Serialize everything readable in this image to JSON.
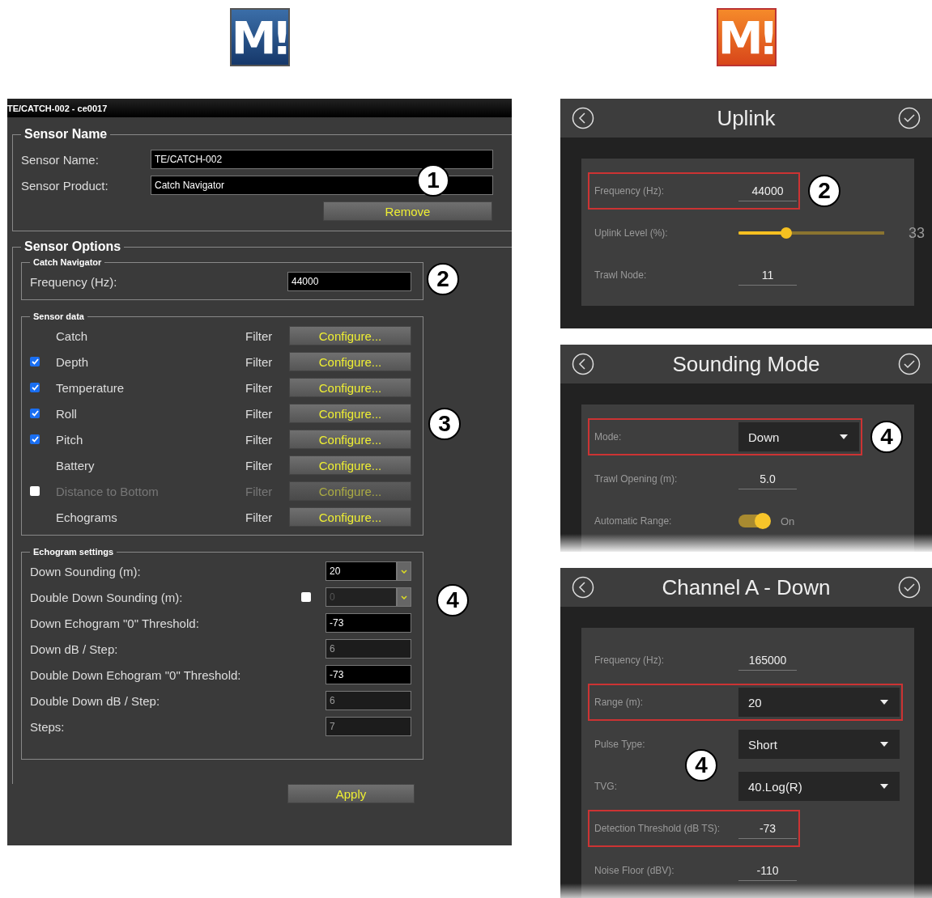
{
  "logos": [
    {
      "text": "M!",
      "kind": "blue"
    },
    {
      "text": "M!",
      "kind": "orange"
    }
  ],
  "desktop": {
    "title": "TE/CATCH-002 - ce0017",
    "sensor_name": {
      "legend": "Sensor Name",
      "callout": "1",
      "fields": [
        {
          "label": "Sensor Name:",
          "value": "TE/CATCH-002"
        },
        {
          "label": "Sensor Product:",
          "value": "Catch Navigator"
        }
      ],
      "button": "Remove"
    },
    "sensor_options": {
      "legend": "Sensor Options",
      "catch_navigator": {
        "legend": "Catch Navigator",
        "callout": "2",
        "label": "Frequency (Hz):",
        "value": "44000"
      },
      "sensor_data": {
        "legend": "Sensor data",
        "callout": "3",
        "rows": [
          {
            "kind": "plain",
            "name": "Catch",
            "filter": "Filter",
            "button": "Configure...",
            "disabled": false
          },
          {
            "kind": "checkbox",
            "checked": true,
            "name": "Depth",
            "filter": "Filter",
            "button": "Configure...",
            "disabled": false
          },
          {
            "kind": "checkbox",
            "checked": true,
            "name": "Temperature",
            "filter": "Filter",
            "button": "Configure...",
            "disabled": false
          },
          {
            "kind": "checkbox",
            "checked": true,
            "name": "Roll",
            "filter": "Filter",
            "button": "Configure...",
            "disabled": false
          },
          {
            "kind": "checkbox",
            "checked": true,
            "name": "Pitch",
            "filter": "Filter",
            "button": "Configure...",
            "disabled": false
          },
          {
            "kind": "plain",
            "name": "Battery",
            "filter": "Filter",
            "button": "Configure...",
            "disabled": false
          },
          {
            "kind": "checkbox",
            "checked": false,
            "name": "Distance to Bottom",
            "filter": "Filter",
            "button": "Configure...",
            "disabled": true
          },
          {
            "kind": "plain",
            "name": "Echograms",
            "filter": "Filter",
            "button": "Configure...",
            "disabled": false
          }
        ]
      },
      "echogram": {
        "legend": "Echogram settings",
        "callout": "4",
        "rows": [
          {
            "kind": "dropdown",
            "label": "Down Sounding (m):",
            "value": "20",
            "disabled": false
          },
          {
            "kind": "checkbox-dropdown",
            "checked": false,
            "label": "Double Down Sounding (m):",
            "value": "0",
            "disabled": true
          },
          {
            "kind": "field",
            "label": "Down Echogram \"0\" Threshold:",
            "value": "-73",
            "disabled": false
          },
          {
            "kind": "field",
            "label": "Down dB / Step:",
            "value": "6",
            "disabled": true
          },
          {
            "kind": "field",
            "label": "Double Down Echogram \"0\" Threshold:",
            "value": "-73",
            "disabled": false
          },
          {
            "kind": "field",
            "label": "Double Down dB / Step:",
            "value": "6",
            "disabled": true
          },
          {
            "kind": "field",
            "label": "Steps:",
            "value": "7",
            "disabled": true
          }
        ]
      }
    },
    "apply": "Apply"
  },
  "mobile_panels": [
    {
      "title": "Uplink",
      "cut_off": false,
      "rows": [
        {
          "kind": "input",
          "label": "Frequency (Hz):",
          "value": "44000",
          "highlighted": true,
          "callout": "2"
        },
        {
          "kind": "slider",
          "label": "Uplink Level (%):",
          "level": 0.33,
          "reading": "33",
          "highlighted": false
        },
        {
          "kind": "input",
          "label": "Trawl Node:",
          "value": "11",
          "highlighted": false
        }
      ]
    },
    {
      "title": "Sounding Mode",
      "cut_off": true,
      "rows": [
        {
          "kind": "dropdown",
          "label": "Mode:",
          "value": "Down",
          "highlighted": true,
          "callout": "4"
        },
        {
          "kind": "input",
          "label": "Trawl Opening (m):",
          "value": "5.0",
          "highlighted": false
        },
        {
          "kind": "toggle",
          "label": "Automatic Range:",
          "on": true,
          "reading": "On",
          "highlighted": false
        }
      ]
    },
    {
      "title": "Channel A - Down",
      "cut_off": true,
      "rows": [
        {
          "kind": "input",
          "label": "Frequency (Hz):",
          "value": "165000",
          "highlighted": false
        },
        {
          "kind": "dropdown",
          "label": "Range (m):",
          "value": "20",
          "highlighted": true
        },
        {
          "kind": "dropdown",
          "label": "Pulse Type:",
          "value": "Short",
          "highlighted": false,
          "callout": "4"
        },
        {
          "kind": "dropdown",
          "label": "TVG:",
          "value": "40.Log(R)",
          "highlighted": false
        },
        {
          "kind": "input",
          "label": "Detection Threshold (dB TS):",
          "value": "-73",
          "highlighted": true
        },
        {
          "kind": "input",
          "label": "Noise Floor (dBV):",
          "value": "-110",
          "highlighted": false
        }
      ]
    }
  ]
}
